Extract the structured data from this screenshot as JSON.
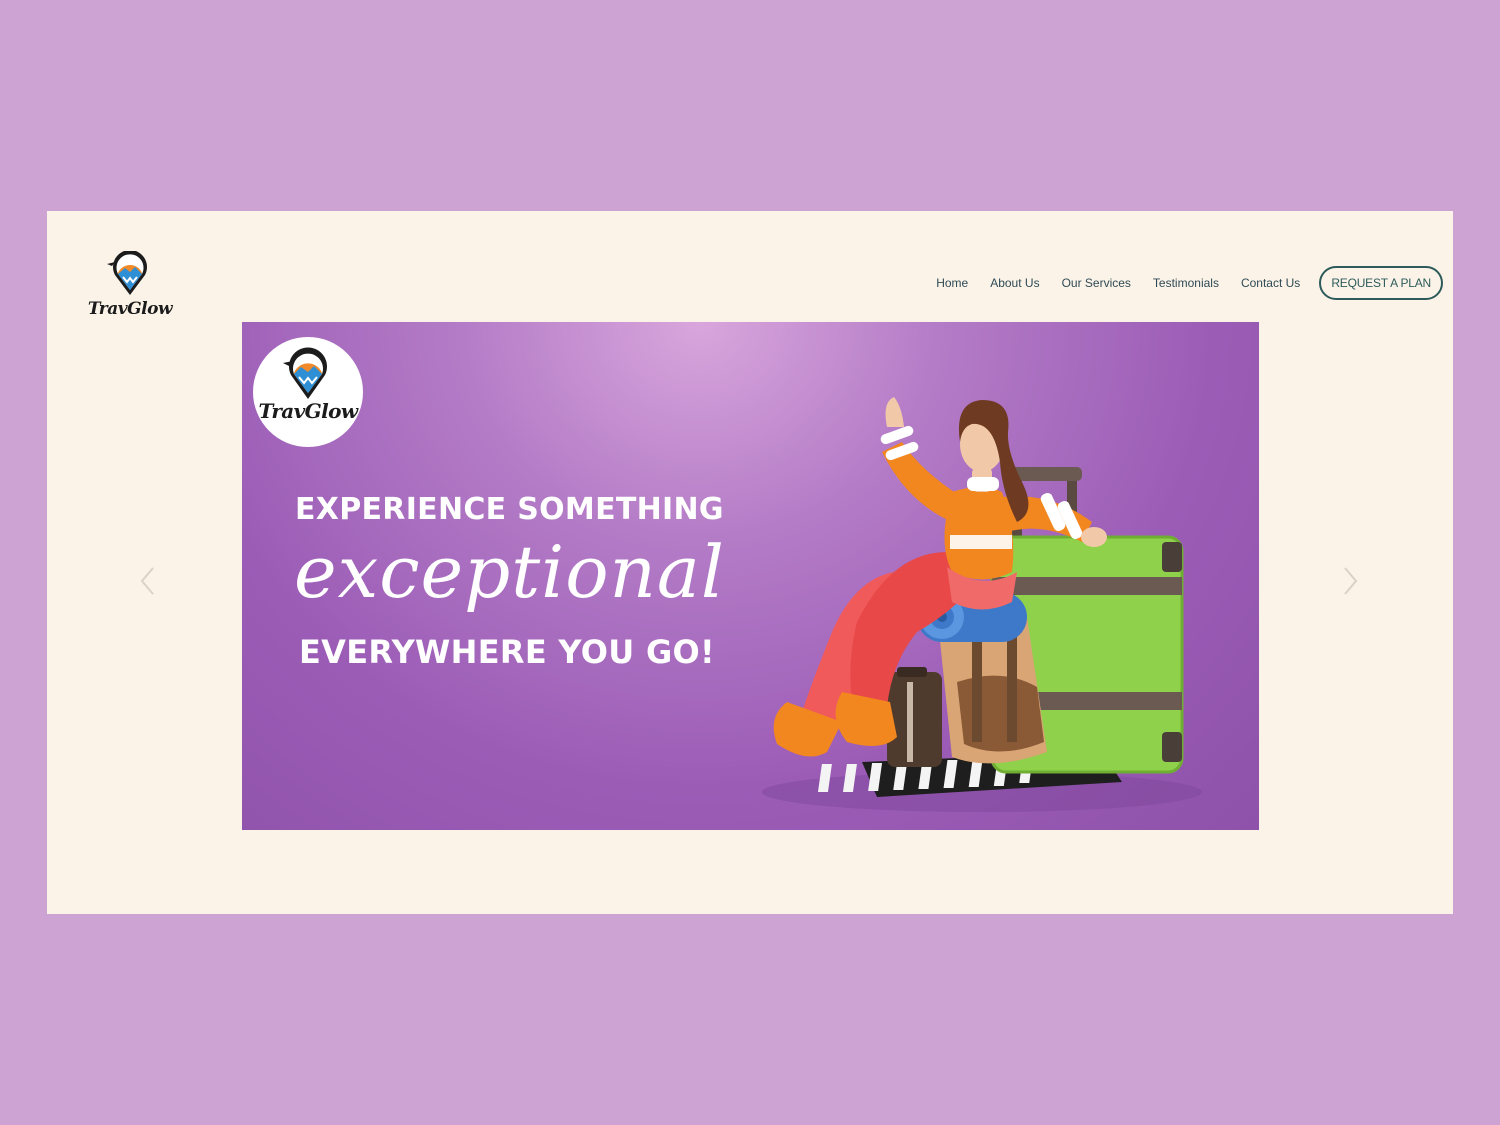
{
  "brand": {
    "name": "TravGlow"
  },
  "nav": {
    "items": [
      "Home",
      "About Us",
      "Our Services",
      "Testimonials",
      "Contact Us"
    ],
    "cta_label": "REQUEST A PLAN"
  },
  "hero": {
    "badge_name": "TravGlow",
    "line1": "EXPERIENCE SOMETHING",
    "script": "exceptional",
    "line2": "EVERYWHERE YOU GO!"
  },
  "icons": {
    "prev": "chevron-left-icon",
    "next": "chevron-right-icon",
    "logo": "map-pin-mountain-icon"
  },
  "colors": {
    "outer_background": "#cda3d4",
    "page_background": "#fbf3e8",
    "banner_purple": "#9b5cb6",
    "accent_teal": "#2d5a5a",
    "logo_orange": "#f08a2b",
    "logo_blue": "#2f8fd4"
  }
}
